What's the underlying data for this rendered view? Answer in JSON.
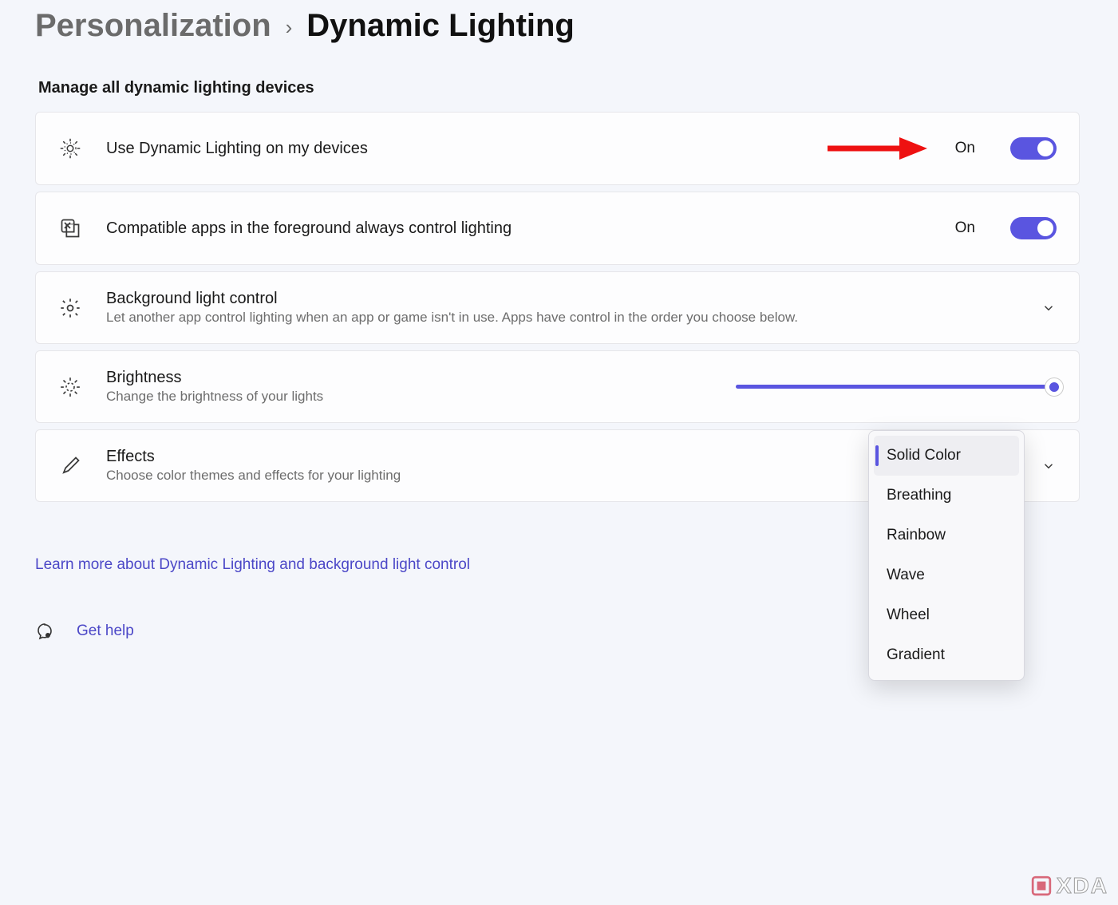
{
  "breadcrumb": {
    "parent": "Personalization",
    "current": "Dynamic Lighting"
  },
  "section_label": "Manage all dynamic lighting devices",
  "cards": {
    "use_dl": {
      "title": "Use Dynamic Lighting on my devices",
      "state": "On"
    },
    "compat": {
      "title": "Compatible apps in the foreground always control lighting",
      "state": "On"
    },
    "bg": {
      "title": "Background light control",
      "desc": "Let another app control lighting when an app or game isn't in use. Apps have control in the order you choose below."
    },
    "brightness": {
      "title": "Brightness",
      "desc": "Change the brightness of your lights",
      "value": 100
    },
    "effects": {
      "title": "Effects",
      "desc": "Choose color themes and effects for your lighting"
    }
  },
  "effects_menu": {
    "selected": "Solid Color",
    "items": [
      "Solid Color",
      "Breathing",
      "Rainbow",
      "Wave",
      "Wheel",
      "Gradient"
    ]
  },
  "learn_more": "Learn more about Dynamic Lighting and background light control",
  "get_help": "Get help",
  "watermark": "XDA",
  "colors": {
    "accent": "#5a55e0"
  }
}
